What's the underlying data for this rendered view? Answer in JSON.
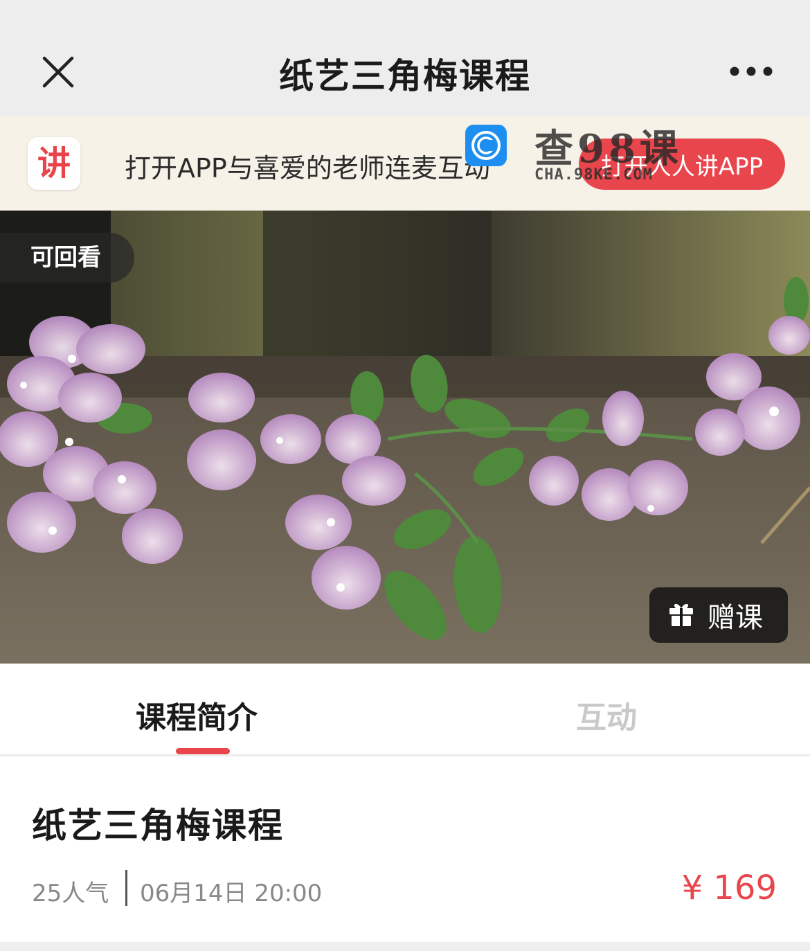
{
  "navbar": {
    "title": "纸艺三角梅课程",
    "close_icon": "close-icon",
    "more_icon": "more-dots-icon"
  },
  "app_banner": {
    "logo_char": "讲",
    "text": "打开APP与喜爱的老师连麦互动",
    "button_label": "打开人人讲APP",
    "accent_color": "#e8464c"
  },
  "watermark": {
    "title": "查98课",
    "subtitle": "CHA.98KE.COM"
  },
  "hero": {
    "replay_badge": "可回看",
    "gift_label": "赠课",
    "gift_icon": "gift-icon"
  },
  "tabs": [
    {
      "label": "课程简介",
      "active": true
    },
    {
      "label": "互动",
      "active": false
    }
  ],
  "course": {
    "title": "纸艺三角梅课程",
    "popularity": "25人气",
    "time": "06月14日 20:00",
    "price": "¥ 169"
  }
}
